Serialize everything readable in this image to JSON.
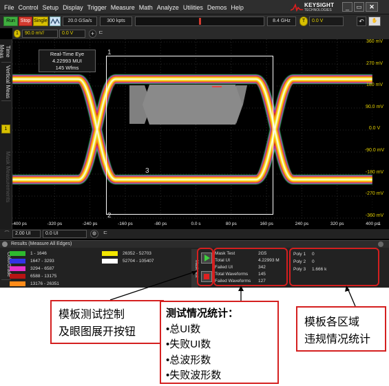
{
  "menu": [
    "File",
    "Control",
    "Setup",
    "Display",
    "Trigger",
    "Measure",
    "Math",
    "Analyze",
    "Utilities",
    "Demos",
    "Help"
  ],
  "logo": {
    "name": "KEYSIGHT",
    "sub": "TECHNOLOGIES"
  },
  "toolbar": {
    "run": "Run",
    "stop": "Stop",
    "single": "Single",
    "sample_rate": "20.0 GSa/s",
    "memory": "300 kpts",
    "bandwidth": "8.4 GHz",
    "trigger_badge": "T",
    "trigger_level": "0.0 V"
  },
  "channel": {
    "badge": "1",
    "scale": "90.0 mV/",
    "offset": "0.0 V"
  },
  "sidebar_tabs": [
    "Time Meas",
    "Vertical Meas",
    "Mask Measurements"
  ],
  "eye_info": {
    "line1": "Real-Time Eye",
    "line2": "4.22993 MUI",
    "line3": "145 Wfms"
  },
  "mask_labels": [
    "1",
    "2",
    "3"
  ],
  "marker": "1",
  "voltage_labels": [
    "360 mV",
    "270 mV",
    "180 mV",
    "90.0 mV",
    "0.0 V",
    "-90.0 mV",
    "-180 mV",
    "-270 mV",
    "-360 mV"
  ],
  "time_labels": [
    "-400 ps",
    "-320 ps",
    "-240 ps",
    "-160 ps",
    "-80 ps",
    "0.0 s",
    "80 ps",
    "160 ps",
    "240 ps",
    "320 ps",
    "400 ps"
  ],
  "time_corner": "1",
  "hscale": {
    "scale": "2.00 UI",
    "position": "0.0 UI"
  },
  "results": {
    "title": "Results   (Measure All Edges)",
    "side_tab": "ColorGrade",
    "legend": [
      {
        "range": "1 - 1646",
        "color": "#2eb82e"
      },
      {
        "range": "1647 - 3293",
        "color": "#3333e6"
      },
      {
        "range": "3294 - 6587",
        "color": "#e633cc"
      },
      {
        "range": "6588 - 13175",
        "color": "#b81414"
      },
      {
        "range": "13176 - 26351",
        "color": "#ff8c1a"
      },
      {
        "range": "26352 - 52703",
        "color": "#f2e600"
      },
      {
        "range": "52704 - 105407",
        "color": "#ffffff"
      }
    ],
    "mask_tab": "Mask test",
    "mask_test": [
      {
        "label": "Mask Test",
        "value": "2G5"
      },
      {
        "label": "Total UI",
        "value": "4.22993 M"
      },
      {
        "label": "Failed UI",
        "value": "342"
      },
      {
        "label": "Total Waveforms",
        "value": "145"
      },
      {
        "label": "Failed Waveforms",
        "value": "127"
      }
    ],
    "polys": [
      {
        "label": "Poly 1",
        "value": "0"
      },
      {
        "label": "Poly 2",
        "value": "0"
      },
      {
        "label": "Poly 3",
        "value": "1.666 k"
      }
    ]
  },
  "callouts": {
    "left": {
      "line1": "模板测试控制",
      "line2": "及眼图展开按钮"
    },
    "middle": {
      "title": "测试情况统计：",
      "items": [
        "总UI数",
        "失败UI数",
        "总波形数",
        "失败波形数"
      ]
    },
    "right": {
      "line1": "模板各区域",
      "line2": "违规情况统计"
    }
  },
  "colors": {
    "run": "#3fae3f",
    "stop": "#d43b2f",
    "single": "#d8c000",
    "trace": "#e6d200",
    "mask": "#808080",
    "highlight": "#d41f1f"
  }
}
